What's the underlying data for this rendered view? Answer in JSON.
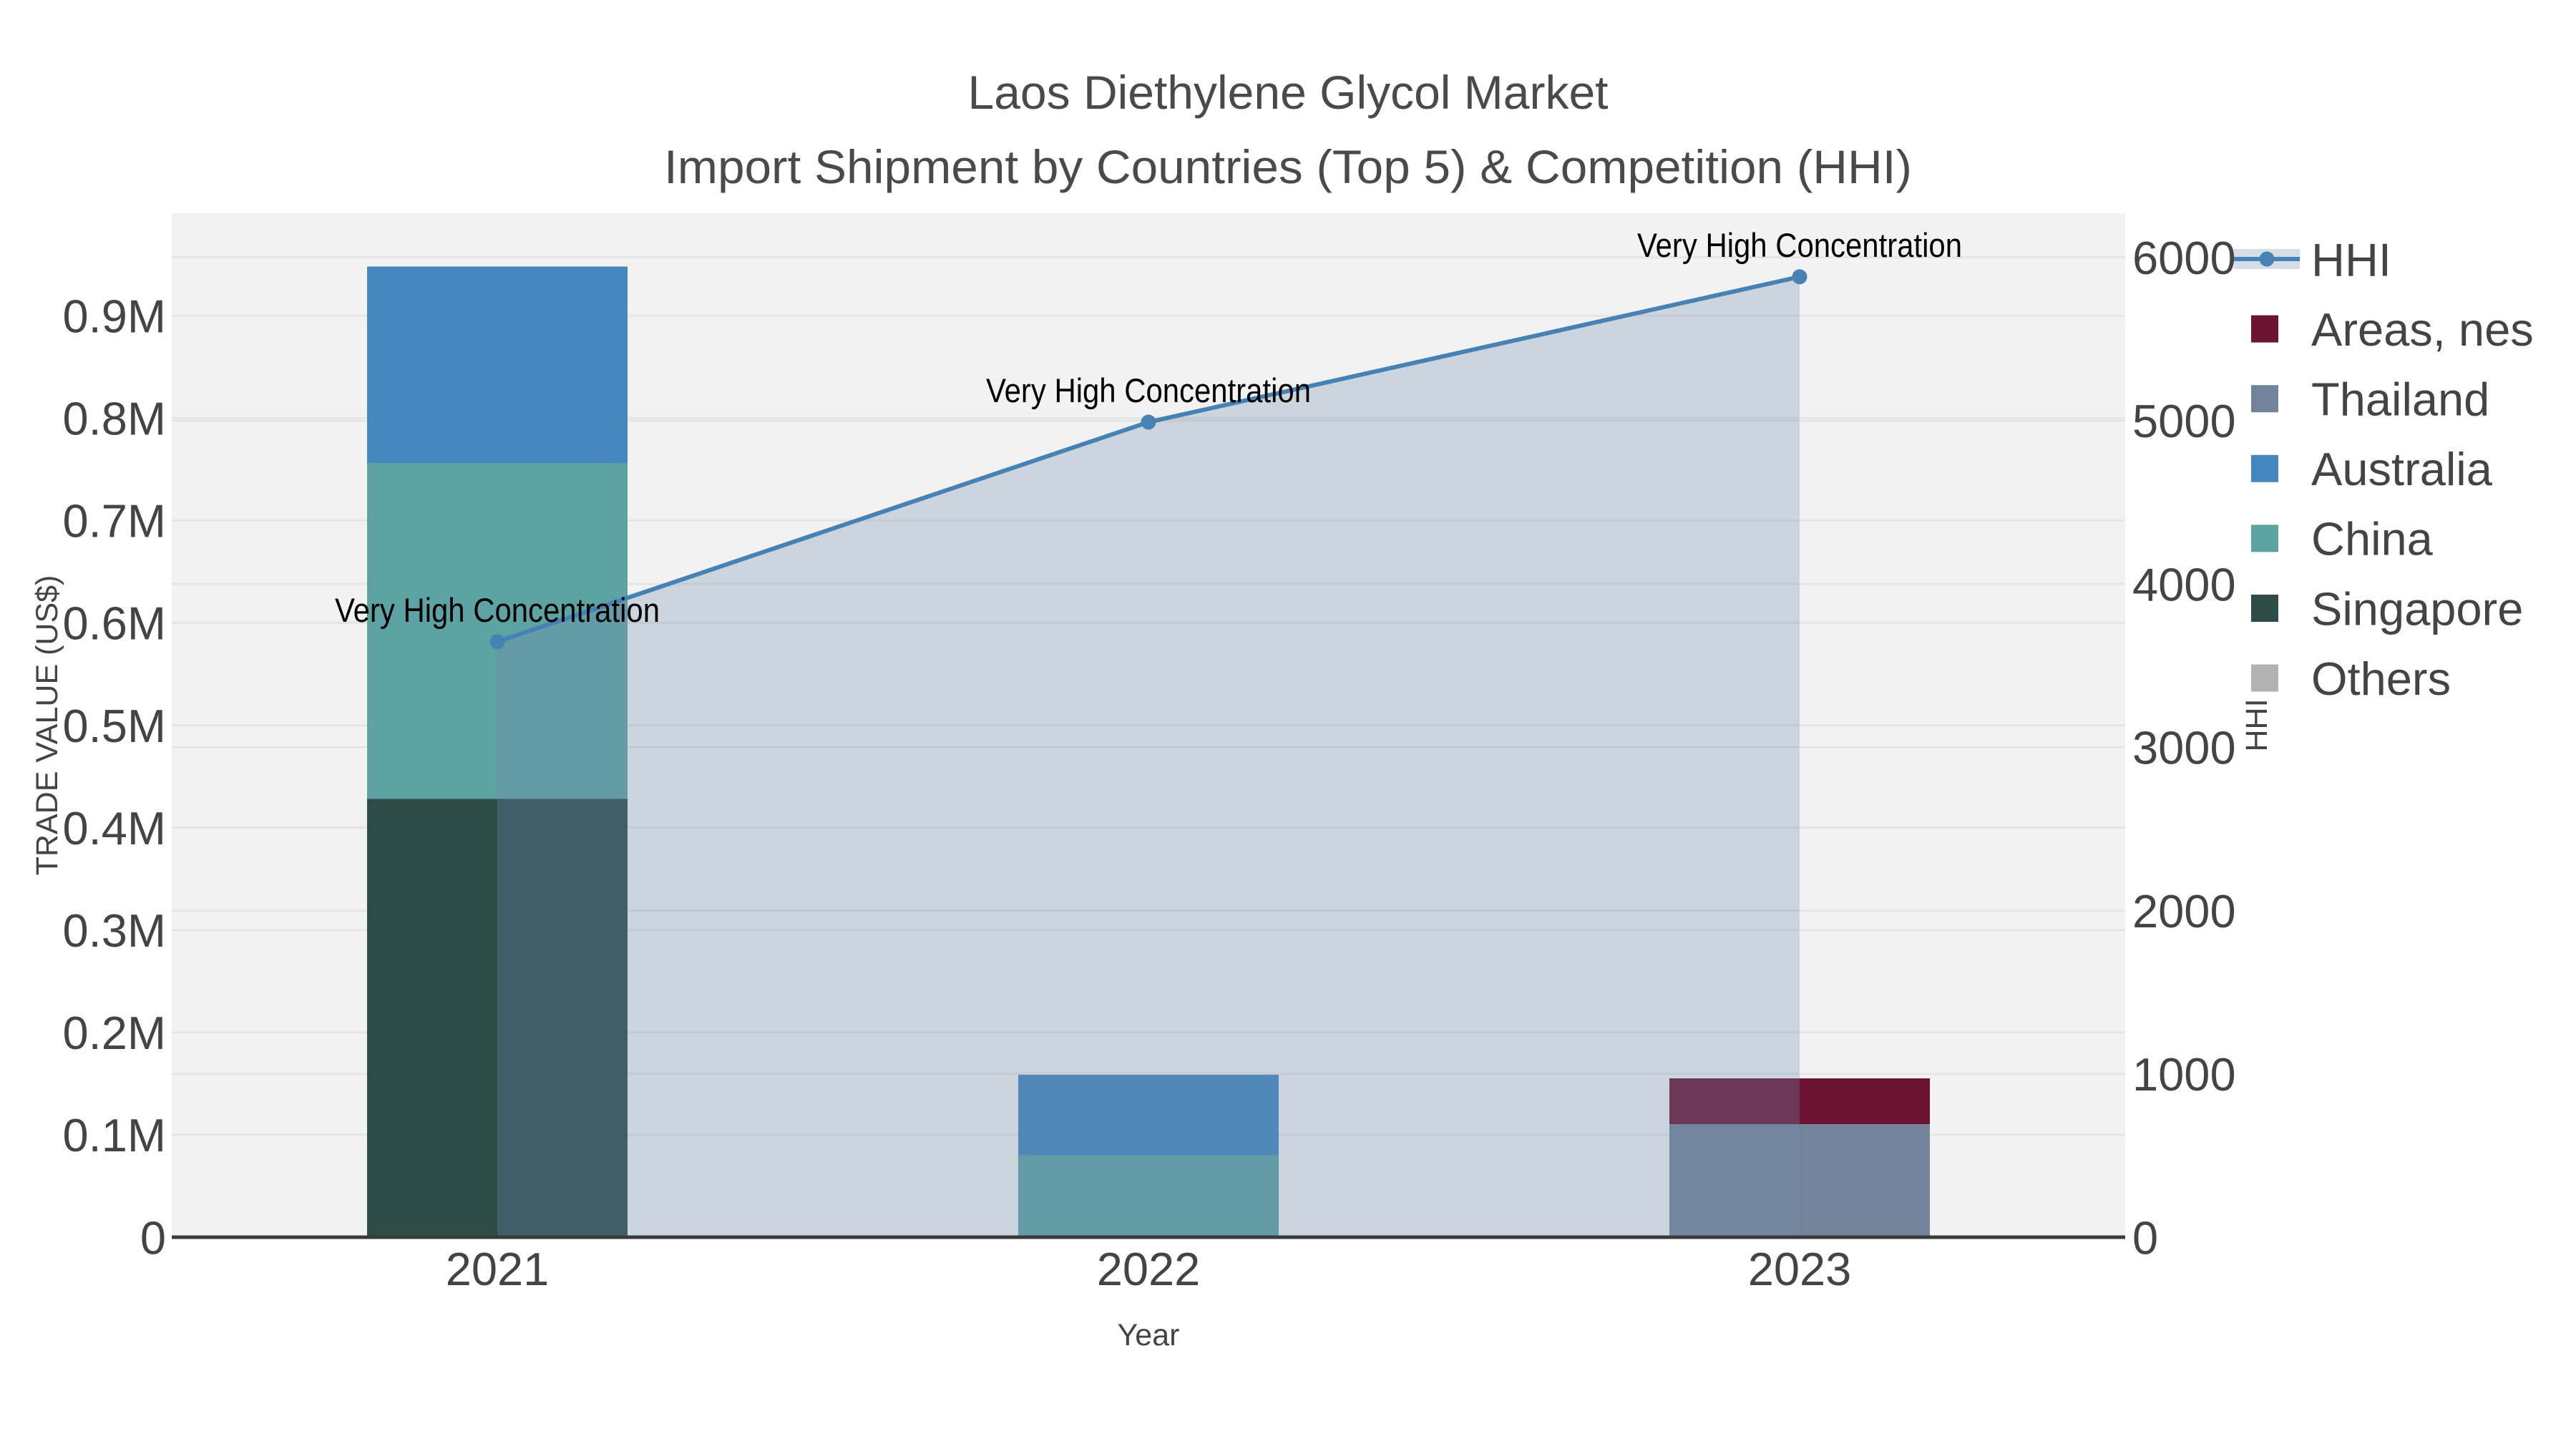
{
  "chart_data": {
    "type": "bar",
    "subtype": "stacked-bar-with-line-overlay",
    "title": "Laos Diethylene Glycol Market",
    "subtitle": "Import Shipment by Countries (Top 5) & Competition (HHI)",
    "xlabel": "Year",
    "ylabel": "TRADE VALUE (US$)",
    "y2label": "HHI",
    "categories": [
      "2021",
      "2022",
      "2023"
    ],
    "ylim": [
      0,
      1000000
    ],
    "y2lim": [
      0,
      6270
    ],
    "grid": true,
    "legend_position": "right",
    "bar_width_fraction": 0.4,
    "bar_series": [
      {
        "name": "Singapore",
        "color": "#2D4B47",
        "values": [
          428000,
          0,
          0
        ]
      },
      {
        "name": "China",
        "color": "#5EA3A3",
        "values": [
          328000,
          80000,
          0
        ]
      },
      {
        "name": "Australia",
        "color": "#4587BF",
        "values": [
          192000,
          78500,
          0
        ]
      },
      {
        "name": "Thailand",
        "color": "#73849A",
        "values": [
          0,
          0,
          110400
        ]
      },
      {
        "name": "Areas, nes",
        "color": "#6E1433",
        "values": [
          0,
          0,
          44800
        ]
      },
      {
        "name": "Others",
        "color": "#B2B2B2",
        "values": [
          0,
          0,
          0
        ]
      }
    ],
    "line_series": {
      "name": "HHI",
      "color": "#4682B4",
      "fill_color": "rgba(112,138,172,0.295)",
      "values": [
        3646,
        4991,
        5881
      ]
    },
    "annotations": [
      {
        "text": "Very High Concentration",
        "category": "2021",
        "value": 3646
      },
      {
        "text": "Very High Concentration",
        "category": "2022",
        "value": 4991
      },
      {
        "text": "Very High Concentration",
        "category": "2023",
        "value": 5881
      }
    ],
    "yticks": [
      {
        "v": 0,
        "label": "0"
      },
      {
        "v": 100000,
        "label": "0.1M"
      },
      {
        "v": 200000,
        "label": "0.2M"
      },
      {
        "v": 300000,
        "label": "0.3M"
      },
      {
        "v": 400000,
        "label": "0.4M"
      },
      {
        "v": 500000,
        "label": "0.5M"
      },
      {
        "v": 600000,
        "label": "0.6M"
      },
      {
        "v": 700000,
        "label": "0.7M"
      },
      {
        "v": 800000,
        "label": "0.8M"
      },
      {
        "v": 900000,
        "label": "0.9M"
      }
    ],
    "y2ticks": [
      {
        "v": 0,
        "label": "0"
      },
      {
        "v": 1000,
        "label": "1000"
      },
      {
        "v": 2000,
        "label": "2000"
      },
      {
        "v": 3000,
        "label": "3000"
      },
      {
        "v": 4000,
        "label": "4000"
      },
      {
        "v": 5000,
        "label": "5000"
      },
      {
        "v": 6000,
        "label": "6000"
      }
    ],
    "legend": [
      {
        "name": "HHI",
        "symbol": "line-marker-fill"
      },
      {
        "name": "Areas, nes",
        "symbol": "square",
        "color": "#6E1433"
      },
      {
        "name": "Thailand",
        "symbol": "square",
        "color": "#73849A"
      },
      {
        "name": "Australia",
        "symbol": "square",
        "color": "#4587BF"
      },
      {
        "name": "China",
        "symbol": "square",
        "color": "#5EA3A3"
      },
      {
        "name": "Singapore",
        "symbol": "square",
        "color": "#2D4B47"
      },
      {
        "name": "Others",
        "symbol": "square",
        "color": "#B2B2B2"
      }
    ],
    "style": {
      "plot_bg": "#F2F2F2",
      "grid_color": "#E5E5E5",
      "axis_line_color": "#3A3A3A",
      "text_color": "#444444",
      "annotation_color": "#000000"
    }
  }
}
